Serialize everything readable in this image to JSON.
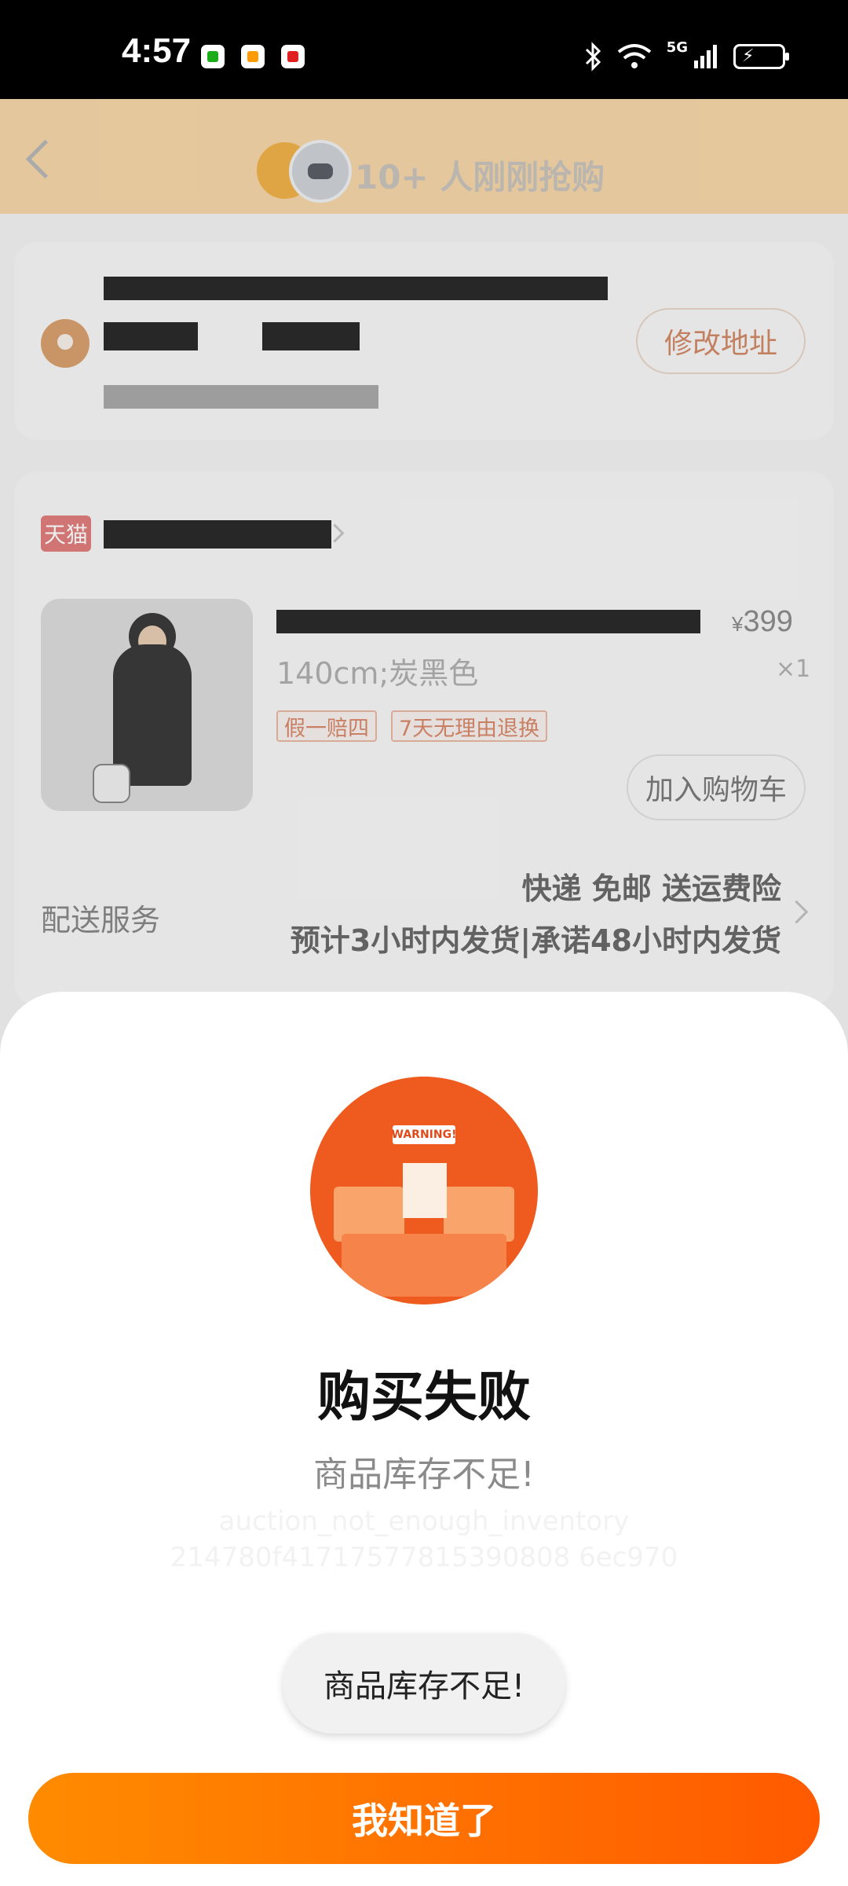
{
  "status_bar": {
    "time": "4:57",
    "network": "5G",
    "app_icons": [
      {
        "name": "wechat-notification-icon",
        "color": "#1aad19"
      },
      {
        "name": "app-notification-icon",
        "color": "#ff9a00"
      },
      {
        "name": "app-notification-icon",
        "color": "#e02020"
      }
    ]
  },
  "header": {
    "promo_text": "10+ 人刚刚抢购"
  },
  "address_card": {
    "change_button": "修改地址"
  },
  "order_card": {
    "shop_badge": "天猫",
    "price_symbol": "¥",
    "price": "399",
    "quantity": "×1",
    "sku": "140cm;炭黑色",
    "tags": [
      "假一赔四",
      "7天无理由退换"
    ],
    "add_to_cart": "加入购物车",
    "delivery_label": "配送服务",
    "delivery_line1": "快递 免邮 送运费险",
    "delivery_line2": "预计3小时内发货|承诺48小时内发货"
  },
  "dialog": {
    "warning_badge": "WARNING!",
    "title": "购买失败",
    "message": "商品库存不足!",
    "error_code": "auction_not_enough_inventory",
    "trace_id": "214780f41717577815390808 6ec970",
    "toast": "商品库存不足!",
    "confirm_button": "我知道了"
  },
  "colors": {
    "accent": "#ff6a00",
    "accent_start": "#ff8b00",
    "accent_end": "#ff5a00",
    "header_bg": "#f6d7a8"
  }
}
